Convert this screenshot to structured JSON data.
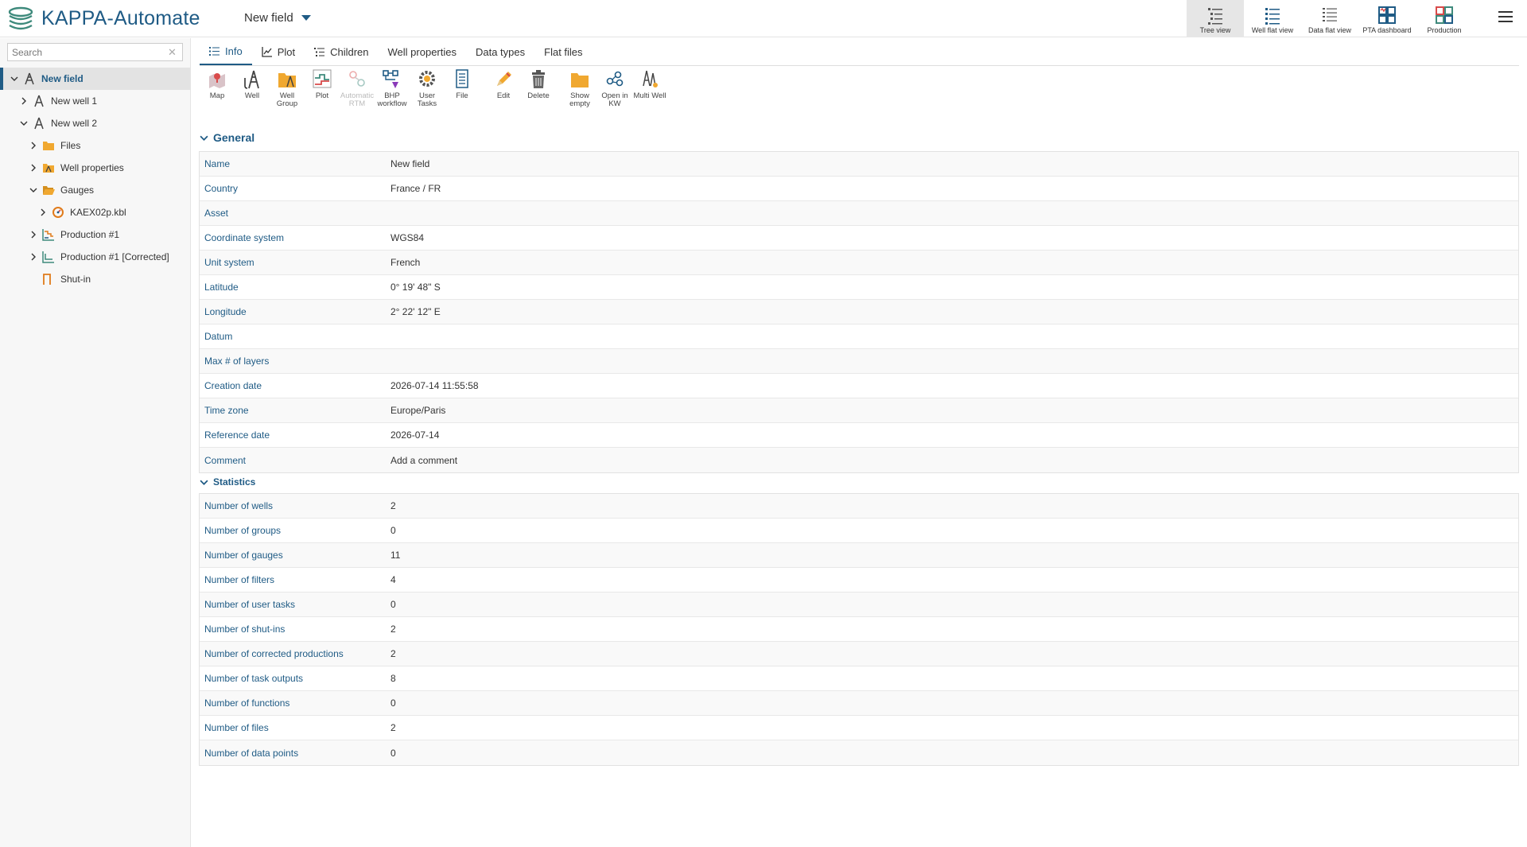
{
  "app": {
    "title": "KAPPA-Automate",
    "field_selector": "New field"
  },
  "views": [
    {
      "label": "Tree view",
      "icon": "tree-view-icon",
      "active": true
    },
    {
      "label": "Well flat view",
      "icon": "well-flat-view-icon"
    },
    {
      "label": "Data flat view",
      "icon": "data-flat-view-icon"
    },
    {
      "label": "PTA dashboard",
      "icon": "pta-dashboard-icon"
    },
    {
      "label": "Production",
      "icon": "production-icon"
    }
  ],
  "sidebar": {
    "search_placeholder": "Search",
    "tree": [
      {
        "label": "New field",
        "icon": "field-icon",
        "expanded": true,
        "selected": true
      },
      {
        "label": "New well 1",
        "icon": "well-icon"
      },
      {
        "label": "New well 2",
        "icon": "well-icon",
        "expanded": true
      },
      {
        "label": "Files",
        "icon": "folder-icon"
      },
      {
        "label": "Well properties",
        "icon": "well-properties-folder-icon"
      },
      {
        "label": "Gauges",
        "icon": "open-folder-icon",
        "expanded": true
      },
      {
        "label": "KAEX02p.kbl",
        "icon": "gauge-icon"
      },
      {
        "label": "Production #1",
        "icon": "production-data-icon"
      },
      {
        "label": "Production #1 [Corrected]",
        "icon": "corrected-production-icon"
      },
      {
        "label": "Shut-in",
        "icon": "shut-in-icon"
      }
    ]
  },
  "tabs": [
    {
      "label": "Info",
      "icon": "list-icon",
      "active": true
    },
    {
      "label": "Plot",
      "icon": "line-chart-icon"
    },
    {
      "label": "Children",
      "icon": "children-icon"
    },
    {
      "label": "Well properties"
    },
    {
      "label": "Data types"
    },
    {
      "label": "Flat files"
    }
  ],
  "toolbar": [
    {
      "label": "Map",
      "icon": "map-icon"
    },
    {
      "label": "Well",
      "icon": "well-add-icon"
    },
    {
      "label": "Well Group",
      "icon": "well-group-icon"
    },
    {
      "label": "Plot",
      "icon": "plot-icon"
    },
    {
      "label": "Automatic RTM",
      "icon": "automatic-rtm-icon",
      "disabled": true
    },
    {
      "label": "BHP workflow",
      "icon": "bhp-workflow-icon"
    },
    {
      "label": "User Tasks",
      "icon": "user-tasks-icon"
    },
    {
      "label": "File",
      "icon": "file-icon"
    },
    {
      "label": "Edit",
      "icon": "pencil-icon"
    },
    {
      "label": "Delete",
      "icon": "trash-icon"
    },
    {
      "label": "Show empty",
      "icon": "show-empty-folder-icon"
    },
    {
      "label": "Open in KW",
      "icon": "open-in-kw-icon"
    },
    {
      "label": "Multi Well",
      "icon": "multi-well-icon"
    }
  ],
  "general": {
    "title": "General",
    "rows": [
      {
        "key": "Name",
        "value": "New field"
      },
      {
        "key": "Country",
        "value": "France / FR"
      },
      {
        "key": "Asset",
        "value": ""
      },
      {
        "key": "Coordinate system",
        "value": "WGS84"
      },
      {
        "key": "Unit system",
        "value": "French"
      },
      {
        "key": "Latitude",
        "value": "0° 19' 48\" S"
      },
      {
        "key": "Longitude",
        "value": "2° 22' 12\" E"
      },
      {
        "key": "Datum",
        "value": ""
      },
      {
        "key": "Max # of layers",
        "value": ""
      },
      {
        "key": "Creation date",
        "value": "2026-07-14 11:55:58"
      },
      {
        "key": "Time zone",
        "value": "Europe/Paris"
      },
      {
        "key": "Reference date",
        "value": "2026-07-14"
      },
      {
        "key": "Comment",
        "value": "Add a comment"
      }
    ]
  },
  "statistics": {
    "title": "Statistics",
    "rows": [
      {
        "key": "Number of wells",
        "value": "2"
      },
      {
        "key": "Number of groups",
        "value": "0"
      },
      {
        "key": "Number of gauges",
        "value": "11"
      },
      {
        "key": "Number of filters",
        "value": "4"
      },
      {
        "key": "Number of user tasks",
        "value": "0"
      },
      {
        "key": "Number of shut-ins",
        "value": "2"
      },
      {
        "key": "Number of corrected productions",
        "value": "2"
      },
      {
        "key": "Number of task outputs",
        "value": "8"
      },
      {
        "key": "Number of functions",
        "value": "0"
      },
      {
        "key": "Number of files",
        "value": "2"
      },
      {
        "key": "Number of data points",
        "value": "0"
      }
    ]
  }
}
